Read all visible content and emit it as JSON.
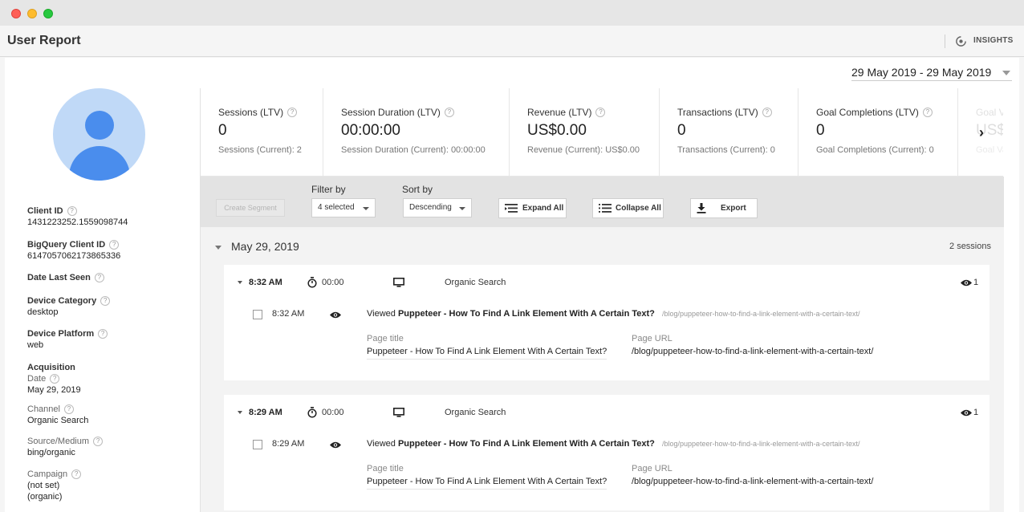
{
  "header": {
    "title": "User Report",
    "insights_label": "INSIGHTS"
  },
  "date_range": "29 May 2019 - 29 May 2019",
  "profile": {
    "fields": [
      {
        "label": "Client ID",
        "value": "1431223252.1559098744"
      },
      {
        "label": "BigQuery Client ID",
        "value": "6147057062173865336"
      },
      {
        "label": "Date Last Seen",
        "value": ""
      },
      {
        "label": "Device Category",
        "value": "desktop"
      },
      {
        "label": "Device Platform",
        "value": "web"
      }
    ],
    "acquisition": {
      "title": "Acquisition",
      "date_label": "Date",
      "date_value": "May 29, 2019",
      "channel_label": "Channel",
      "channel_value": "Organic Search",
      "source_label": "Source/Medium",
      "source_value": "bing/organic",
      "campaign_label": "Campaign",
      "campaign_value_1": "(not set)",
      "campaign_value_2": "(organic)"
    }
  },
  "metrics": [
    {
      "label": "Sessions (LTV)",
      "value": "0",
      "current": "Sessions (Current): 2"
    },
    {
      "label": "Session Duration (LTV)",
      "value": "00:00:00",
      "current": "Session Duration (Current): 00:00:00"
    },
    {
      "label": "Revenue (LTV)",
      "value": "US$0.00",
      "current": "Revenue (Current): US$0.00"
    },
    {
      "label": "Transactions (LTV)",
      "value": "0",
      "current": "Transactions (Current): 0"
    },
    {
      "label": "Goal Completions (LTV)",
      "value": "0",
      "current": "Goal Completions (Current): 0"
    },
    {
      "label": "Goal Va",
      "value": "US$",
      "current": "Goal Va"
    }
  ],
  "toolbar": {
    "create_segment": "Create Segment",
    "filter_label": "Filter by",
    "filter_value": "4 selected",
    "sort_label": "Sort by",
    "sort_value": "Descending",
    "expand_all": "Expand All",
    "collapse_all": "Collapse All",
    "export": "Export"
  },
  "session_group": {
    "date": "May 29, 2019",
    "count": "2 sessions",
    "sessions": [
      {
        "time": "8:32 AM",
        "duration": "00:00",
        "channel": "Organic Search",
        "views": "1",
        "hit": {
          "time": "8:32 AM",
          "viewed_prefix": "Viewed",
          "title": "Puppeteer - How To Find A Link Element With A Certain Text?",
          "url": "/blog/puppeteer-how-to-find-a-link-element-with-a-certain-text/",
          "page_title_label": "Page title",
          "page_url_label": "Page URL"
        }
      },
      {
        "time": "8:29 AM",
        "duration": "00:00",
        "channel": "Organic Search",
        "views": "1",
        "hit": {
          "time": "8:29 AM",
          "viewed_prefix": "Viewed",
          "title": "Puppeteer - How To Find A Link Element With A Certain Text?",
          "url": "/blog/puppeteer-how-to-find-a-link-element-with-a-certain-text/",
          "page_title_label": "Page title",
          "page_url_label": "Page URL"
        }
      }
    ]
  }
}
